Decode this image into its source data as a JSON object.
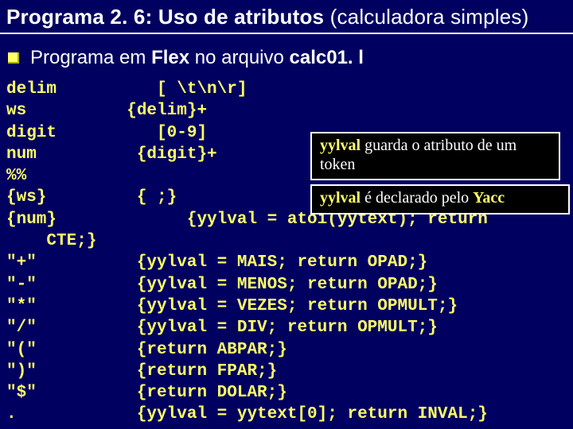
{
  "title": {
    "strong": "Programa 2. 6:  Uso de atributos",
    "rest": " (calculadora simples)"
  },
  "subtitle": {
    "p1": "Programa em ",
    "p2": "Flex",
    "p3": " no arquivo ",
    "p4": "calc01. l"
  },
  "code": "delim          [ \\t\\n\\r]\nws          {delim}+\ndigit          [0-9]\nnum          {digit}+\n%%\n{ws}         { ;}\n{num}             {yylval = atoi(yytext); return\n    CTE;}\n\"+\"          {yylval = MAIS; return OPAD;}\n\"-\"          {yylval = MENOS; return OPAD;}\n\"*\"          {yylval = VEZES; return OPMULT;}\n\"/\"          {yylval = DIV; return OPMULT;}\n\"(\"          {return ABPAR;}\n\")\"          {return FPAR;}\n\"$\"          {return DOLAR;}\n.            {yylval = yytext[0]; return INVAL;}",
  "annot1": {
    "kw": "yylval",
    "rest": " guarda o atributo de um token"
  },
  "annot2": {
    "kw": "yylval",
    "mid": " é declarado pelo ",
    "kw2": "Yacc"
  }
}
